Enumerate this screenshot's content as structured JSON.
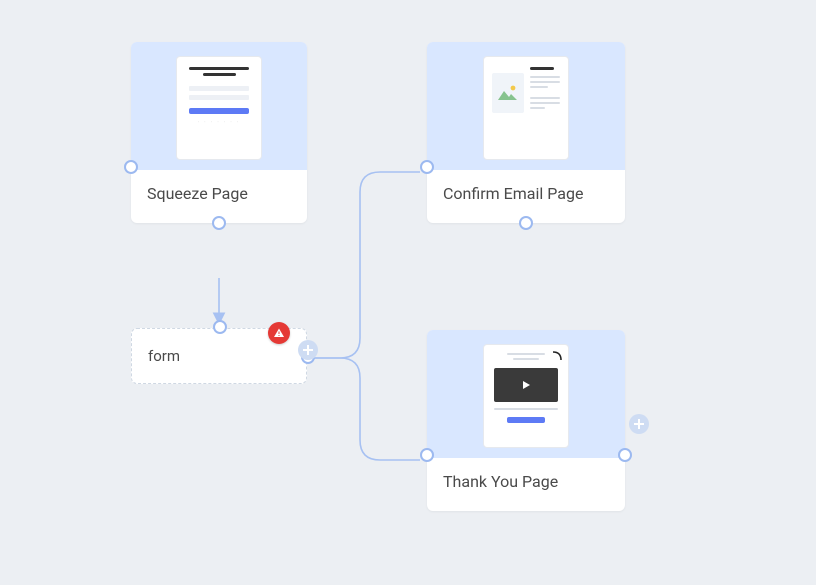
{
  "nodes": {
    "squeeze": {
      "label": "Squeeze Page"
    },
    "form": {
      "label": "form"
    },
    "confirm": {
      "label": "Confirm Email Page"
    },
    "thankyou": {
      "label": "Thank You Page"
    }
  },
  "icons": {
    "error_badge": "warning-triangle",
    "add": "plus",
    "play": "play",
    "image": "mountain-sun"
  }
}
